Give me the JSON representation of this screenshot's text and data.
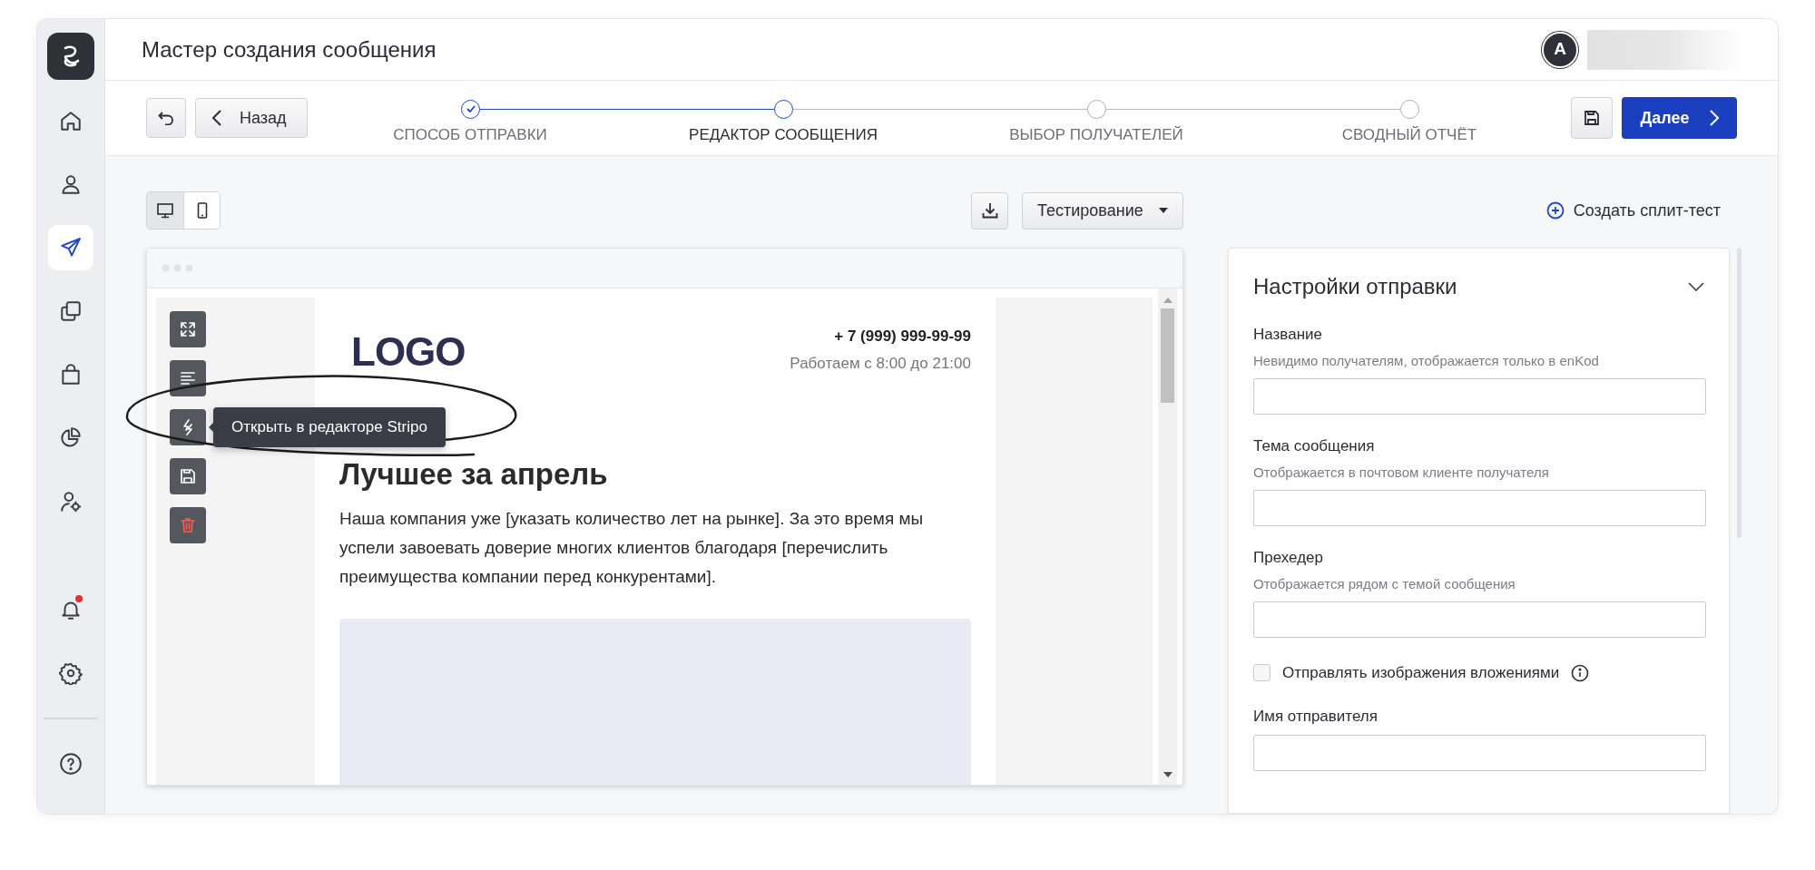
{
  "app_title": "Мастер создания сообщения",
  "user": {
    "avatar_letter": "А"
  },
  "sidebar": {
    "items": [
      {
        "kind": "home",
        "selected": false
      },
      {
        "kind": "user",
        "selected": false
      },
      {
        "kind": "send",
        "selected": true
      },
      {
        "kind": "copy",
        "selected": false
      },
      {
        "kind": "bag",
        "selected": false
      },
      {
        "kind": "chart",
        "selected": false
      },
      {
        "kind": "user-settings",
        "selected": false
      },
      {
        "kind": "bell",
        "selected": false,
        "badge": true
      },
      {
        "kind": "settings",
        "selected": false
      },
      {
        "kind": "help",
        "selected": false
      }
    ]
  },
  "back_button": "Назад",
  "steps": [
    {
      "label": "СПОСОБ ОТПРАВКИ",
      "completed": true,
      "selected": false
    },
    {
      "label": "РЕДАКТОР СООБЩЕНИЯ",
      "completed": false,
      "selected": true
    },
    {
      "label": "ВЫБОР ПОЛУЧАТЕЛЕЙ",
      "completed": false,
      "selected": false
    },
    {
      "label": "СВОДНЫЙ ОТЧЁТ",
      "completed": false,
      "selected": false
    }
  ],
  "next_button": "Далее",
  "view_toggle": [
    {
      "kind": "desktop",
      "selected": true
    },
    {
      "kind": "mobile",
      "selected": false
    }
  ],
  "testing_button": "Тестирование",
  "split_test_link": "Создать сплит-тест",
  "email_preview": {
    "tools": [
      {
        "kind": "expand"
      },
      {
        "kind": "text"
      },
      {
        "kind": "stripo",
        "tooltip": "Открыть в редакторе Stripo"
      },
      {
        "kind": "save"
      },
      {
        "kind": "delete"
      }
    ],
    "logo": "LOGO",
    "phone": "+ 7 (999) 999-99-99",
    "hours": "Работаем с 8:00 до 21:00",
    "heading": "Лучшее за апрель",
    "body": "Наша компания уже [указать количество лет на рынке]. За это время мы успели завоевать доверие многих клиентов благодаря [перечислить преимущества компании перед конкурентами]."
  },
  "settings_panel": {
    "title": "Настройки отправки",
    "expanded": true,
    "fields": [
      {
        "kind": "input",
        "label": "Название",
        "hint": "Невидимо получателям, отображается только в enKod"
      },
      {
        "kind": "input",
        "label": "Тема сообщения",
        "hint": "Отображается в почтовом клиенте получателя"
      },
      {
        "kind": "input",
        "label": "Прехедер",
        "hint": "Отображается рядом с темой сообщения"
      },
      {
        "kind": "checkbox",
        "label": "Отправлять изображения вложениями",
        "checked": false
      },
      {
        "kind": "input",
        "label": "Имя отправителя"
      }
    ]
  }
}
